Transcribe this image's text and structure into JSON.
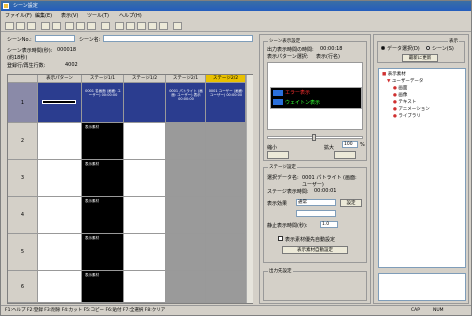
{
  "title": "シーン設定",
  "menu": [
    "ファイル(F)",
    "編集(E)",
    "表示(V)",
    "ツール(T)",
    "ヘルプ(H)"
  ],
  "left": {
    "scene_no_label": "シーンNo.:",
    "scene_name_label": "シーン名:",
    "scene_time_label": "シーン表示時間(秒):",
    "scene_time_value": "000018",
    "total_time_value": "(約18秒)",
    "display_layers_label": "登録行/再生行数:",
    "display_layers_value": "4002",
    "columns": [
      "表示パターン",
      "ステージ1/1",
      "ステージ1/2",
      "ステージ2/1",
      "ステージ2/2"
    ],
    "rows": [
      "1",
      "2",
      "3",
      "4",
      "5",
      "6"
    ],
    "cell_tag": "表示素材",
    "row1": {
      "c1": "0001 名画面 (画面: ユーザー) 00:00:00",
      "c3": "0001 パトライト (画面: ユーザー) 表示 00:00:00",
      "c4": "0001 ユーザー (画面: ユーザー) 00:00:00"
    }
  },
  "middle": {
    "preview_title": "シーン表示設定",
    "display_time_label": "出力表示時間の時間:",
    "display_time_value": "00:00:18",
    "image_label": "表示パターン選択:",
    "image_value": "表示(行名)",
    "preview_line1": "エラー表示",
    "preview_line2": "ウェイトン表示",
    "slider_min": "縮小",
    "slider_max": "拡大",
    "zoom_value": "100",
    "zoom_unit": "%",
    "stage_title": "ステージ設定",
    "stage_data_label": "選択データ名:",
    "stage_data_value": "0001 パトライト (画面: ユーザー)",
    "stage_time_label": "ステージ表示時間:",
    "stage_time_value": "00:00:01",
    "effect_label": "表示効果",
    "effect_value": "通常",
    "effect_button": "設定",
    "repeat_label": "静止表示時間(秒):",
    "repeat_value": "1.0",
    "check_label": "表示素材優先自動設定",
    "check_button": "表示素材自動設定",
    "output_title": "出力先設定"
  },
  "right": {
    "group_title": "表示",
    "radio1": "データ選択(D)",
    "radio2": "シーン(S)",
    "update_button": "最新に更新",
    "tree": [
      "表示素材",
      "ユーザーデータ",
      "画面",
      "画像",
      "テキスト",
      "アニメーション",
      "ライブラリ"
    ]
  },
  "status": {
    "left": "F1:ヘルプ F2:登録 F3:削除 F4:カット F5:コピー F6:貼付 F7:全選択 F8:クリア",
    "mode": "CAP",
    "num": "NUM"
  }
}
